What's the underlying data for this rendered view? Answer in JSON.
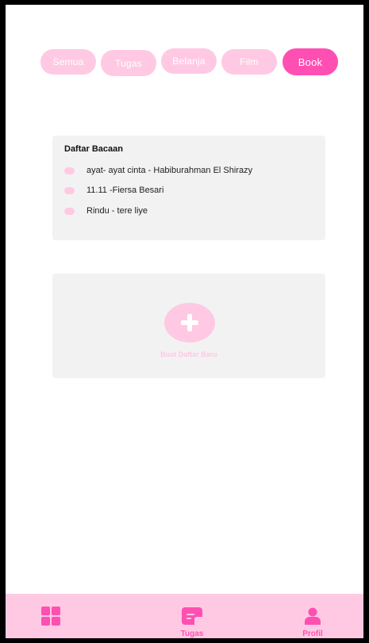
{
  "categories": {
    "tabs": [
      {
        "label": "Semua",
        "active": false
      },
      {
        "label": "Tugas",
        "active": false
      },
      {
        "label": "Belanja",
        "active": false
      },
      {
        "label": "Film",
        "active": false
      },
      {
        "label": "Book",
        "active": true
      }
    ]
  },
  "reading_list": {
    "title": "Daftar Bacaan",
    "items": [
      {
        "text": "ayat- ayat cinta - Habiburahman El Shirazy"
      },
      {
        "text": "11.11 -Fiersa Besari"
      },
      {
        "text": "Rindu - tere liye"
      }
    ]
  },
  "new_list": {
    "label": "Buat Daftar Baru",
    "icon": "plus-icon"
  },
  "bottom_nav": {
    "items": [
      {
        "icon": "grid-icon",
        "label": ""
      },
      {
        "icon": "note-icon",
        "label": "Tugas"
      },
      {
        "icon": "user-icon",
        "label": "Profil"
      }
    ]
  },
  "colors": {
    "accent": "#ff4fb2",
    "accent_light": "#ffc9e3",
    "card_bg": "#f2f2f2",
    "frame": "#000000"
  }
}
